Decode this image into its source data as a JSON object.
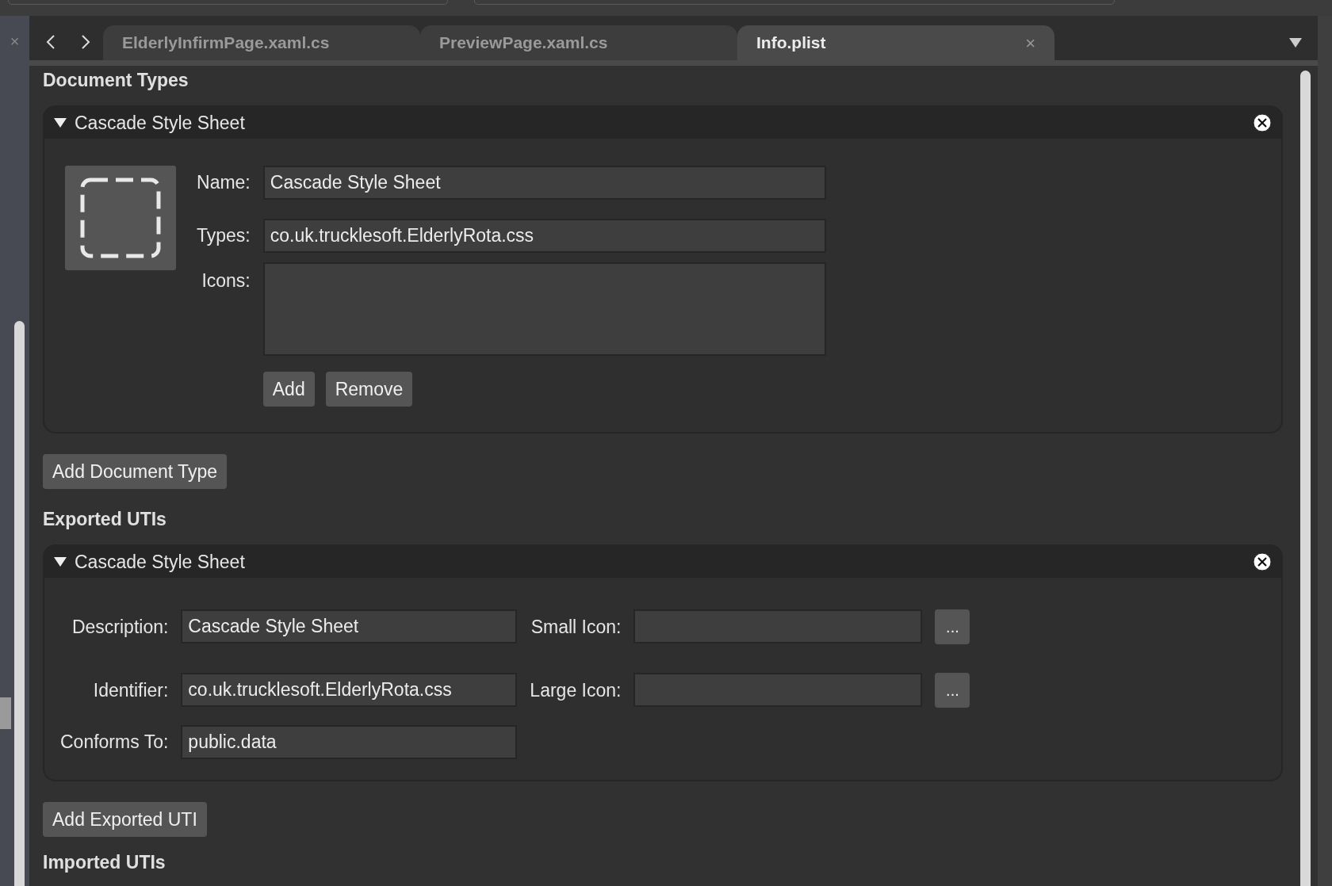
{
  "side_close": "×",
  "tabs": [
    {
      "label": "ElderlyInfirmPage.xaml.cs",
      "selected": false
    },
    {
      "label": "PreviewPage.xaml.cs",
      "selected": false
    },
    {
      "label": "Info.plist",
      "selected": true,
      "close": "×"
    }
  ],
  "document_types": {
    "heading": "Document Types",
    "items": [
      {
        "title": "Cascade Style Sheet",
        "expanded": true,
        "name_label": "Name:",
        "name": "Cascade Style Sheet",
        "types_label": "Types:",
        "types": "co.uk.trucklesoft.ElderlyRota.css",
        "icons_label": "Icons:",
        "add": "Add",
        "remove": "Remove"
      }
    ],
    "add_button": "Add Document Type"
  },
  "exported_utis": {
    "heading": "Exported UTIs",
    "items": [
      {
        "title": "Cascade Style Sheet",
        "expanded": true,
        "description_label": "Description:",
        "description": "Cascade Style Sheet",
        "identifier_label": "Identifier:",
        "identifier": "co.uk.trucklesoft.ElderlyRota.css",
        "conforms_label": "Conforms To:",
        "conforms": "public.data",
        "small_icon_label": "Small Icon:",
        "large_icon_label": "Large Icon:",
        "browse": "..."
      }
    ],
    "add_button": "Add Exported UTI"
  },
  "imported_utis": {
    "heading": "Imported UTIs"
  }
}
